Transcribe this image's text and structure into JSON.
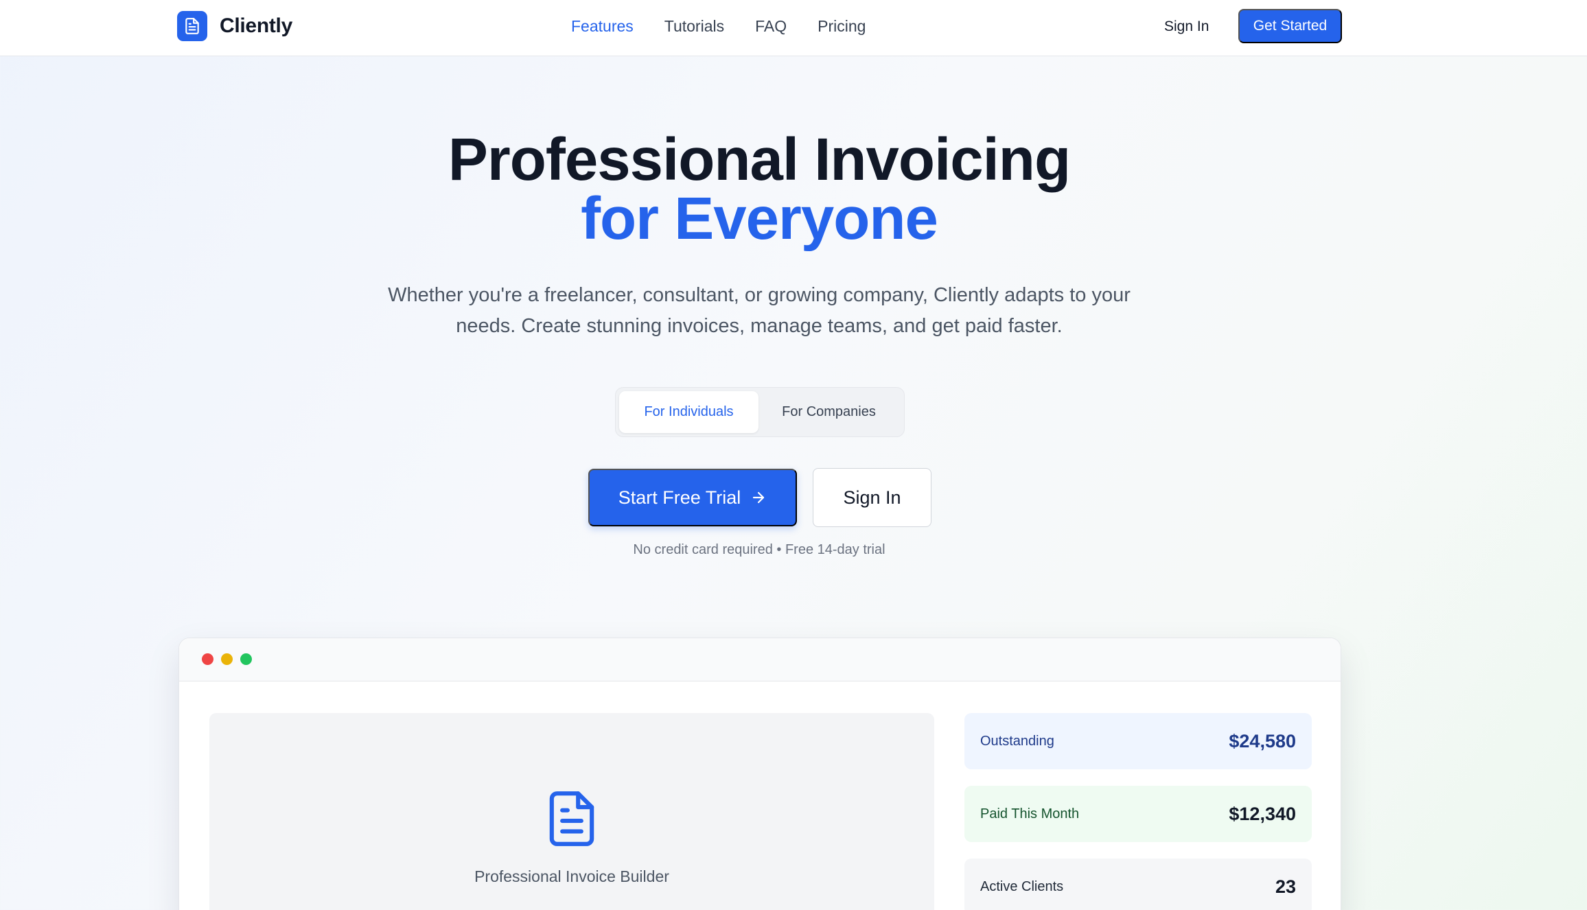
{
  "brand": {
    "name": "Cliently",
    "accent": "#2563eb"
  },
  "nav": {
    "links": [
      {
        "label": "Features",
        "active": true
      },
      {
        "label": "Tutorials",
        "active": false
      },
      {
        "label": "FAQ",
        "active": false
      },
      {
        "label": "Pricing",
        "active": false
      }
    ],
    "sign_in": "Sign In",
    "cta": "Get Started"
  },
  "hero": {
    "title_line1": "Professional Invoicing",
    "title_line2": "for Everyone",
    "subtitle": "Whether you're a freelancer, consultant, or growing company, Cliently adapts to your needs. Create stunning invoices, manage teams, and get paid faster.",
    "toggle": {
      "selected": "For Individuals",
      "options": [
        "For Individuals",
        "For Companies"
      ]
    },
    "primary_cta": "Start Free Trial",
    "secondary_cta": "Sign In",
    "fine_print": "No credit card required • Free 14-day trial"
  },
  "preview": {
    "builder_label": "Professional Invoice Builder",
    "builder_icon": "document-icon",
    "stats": [
      {
        "label": "Outstanding",
        "value": "$24,580"
      },
      {
        "label": "Paid This Month",
        "value": "$12,340"
      },
      {
        "label": "Active Clients",
        "value": "23"
      }
    ]
  }
}
